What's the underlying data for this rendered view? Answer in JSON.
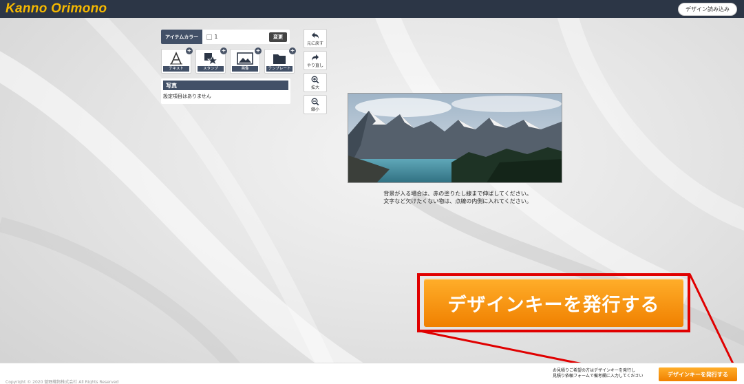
{
  "header": {
    "logo": "Kanno Orimono",
    "load_design": "デザイン読み込み"
  },
  "left_panel": {
    "item_color_label": "アイテムカラー",
    "item_color_value": "1",
    "change_button": "変更",
    "tools": [
      {
        "label": "テキスト",
        "icon": "text-icon"
      },
      {
        "label": "スタンプ",
        "icon": "stamp-icon"
      },
      {
        "label": "画像",
        "icon": "image-icon"
      },
      {
        "label": "テンプレート",
        "icon": "folder-icon"
      }
    ],
    "properties": {
      "title": "写真",
      "text": "設定項目はありません"
    }
  },
  "side_controls": {
    "undo": "元に戻す",
    "redo": "やり直し",
    "zoom_in": "拡大",
    "zoom_out": "縮小"
  },
  "canvas": {
    "note_line1": "背景が入る場合は、赤の塗りたし線まで伸ばしてください。",
    "note_line2": "文字など欠けたくない物は、点線の内側に入れてください。"
  },
  "cta": {
    "big_label": "デザインキーを発行する",
    "small_label": "デザインキーを発行する"
  },
  "footer": {
    "copyright": "Copyright © 2020 菅野織物株式会社 All Rights Reserved",
    "note_line1": "お見積りご希望の方はデザインキーを発行し",
    "note_line2": "見積り依頼フォームで備考欄に入力してください"
  },
  "colors": {
    "header_bg": "#2c3646",
    "logo": "#f5b800",
    "accent_orange": "#f08000",
    "highlight_red": "#e00000"
  }
}
